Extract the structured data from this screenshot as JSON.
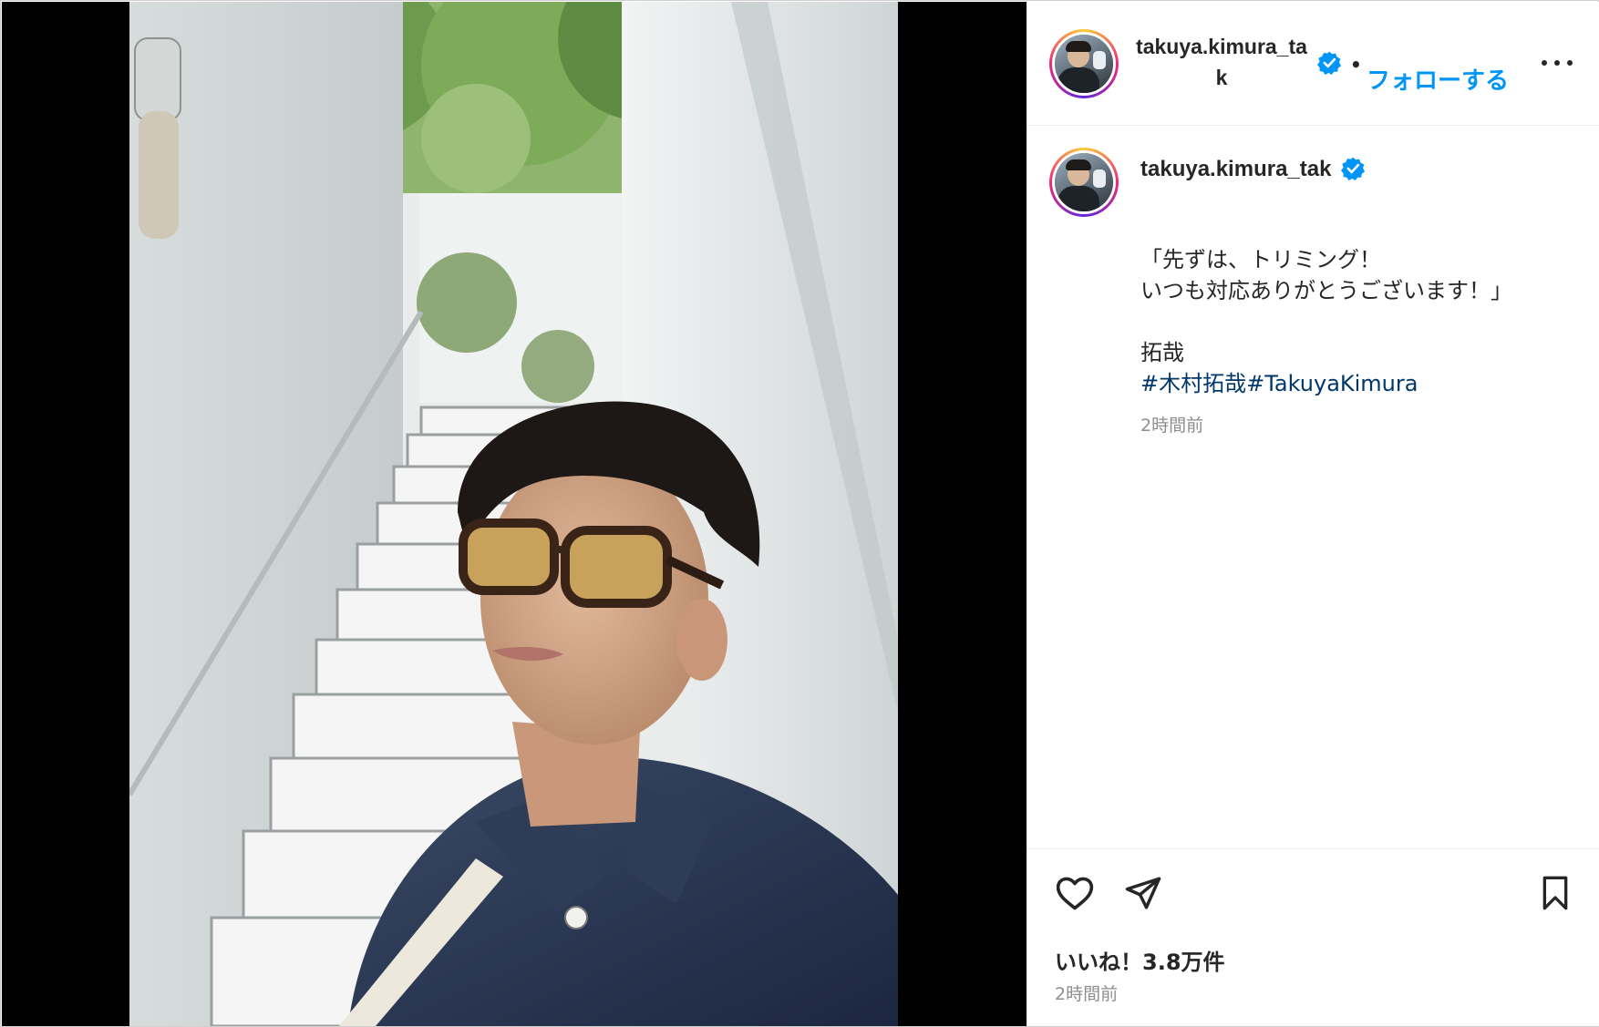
{
  "post": {
    "username_header": "takuya.kimura_tak",
    "username_caption": "takuya.kimura_tak",
    "follow_label": "フォローする",
    "separator": "•",
    "caption_lines": [
      "「先ずは、トリミング！",
      "いつも対応ありがとうございます！」",
      "拓哉"
    ],
    "hashtags": [
      "#木村拓哉",
      "#TakuyaKimura"
    ],
    "caption_time": "2時間前",
    "likes": "いいね！3.8万件",
    "footer_time": "2時間前"
  },
  "icons": {
    "verified": "verified-badge-icon",
    "more": "more-options-icon",
    "like": "heart-icon",
    "share": "paper-plane-icon",
    "save": "bookmark-icon"
  },
  "colors": {
    "accent": "#0095f6",
    "verified": "#0095f6",
    "hashtag": "#00376b",
    "muted": "#8e8e8e",
    "text": "#262626"
  }
}
